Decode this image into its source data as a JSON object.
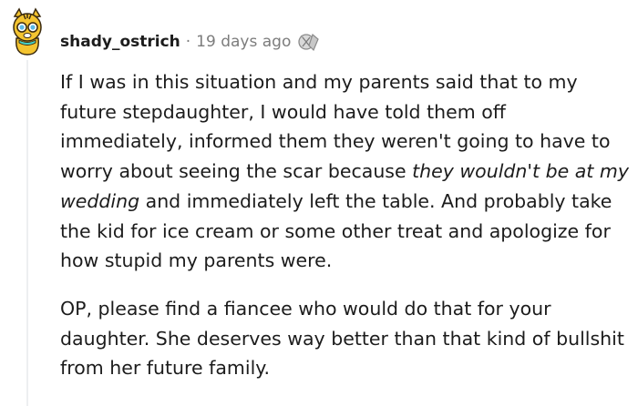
{
  "comment": {
    "username": "shady_ostrich",
    "separator": "·",
    "timestamp": "19 days ago",
    "award_icon": "silver-award-icon",
    "paragraphs": [
      {
        "before_em": "If I was in this situation and my parents said that to my future stepdaughter, I would have told them off immediately, informed them they weren't going to have to worry about seeing the scar because ",
        "em": "they wouldn't be at my wedding",
        "after_em": " and immediately left the table. And probably take the kid for ice cream or some other treat and apologize for how stupid my parents were."
      },
      {
        "text": "OP, please find a fiancee who would do that for your daughter. She deserves way better than that kind of bullshit from her future family."
      }
    ]
  }
}
